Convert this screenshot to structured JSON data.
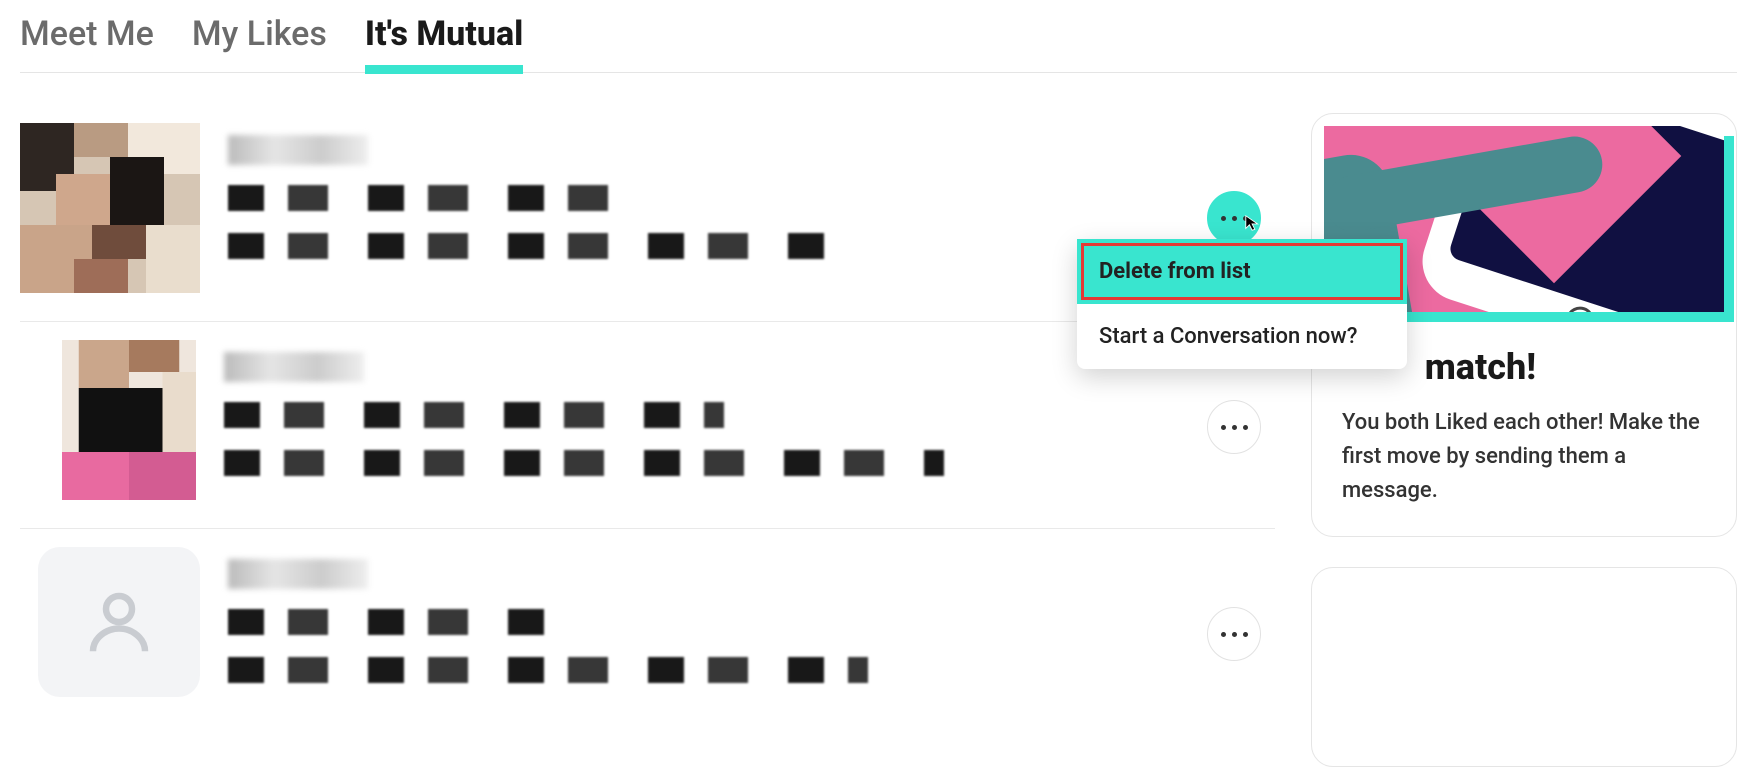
{
  "tabs": {
    "meet_me": "Meet Me",
    "my_likes": "My Likes",
    "its_mutual": "It's Mutual"
  },
  "dropdown": {
    "delete": "Delete from list",
    "start_conv": "Start a Conversation now?"
  },
  "match_card": {
    "title_suffix": "match!",
    "body": "You both Liked each other! Make the first move by sending them a message."
  }
}
